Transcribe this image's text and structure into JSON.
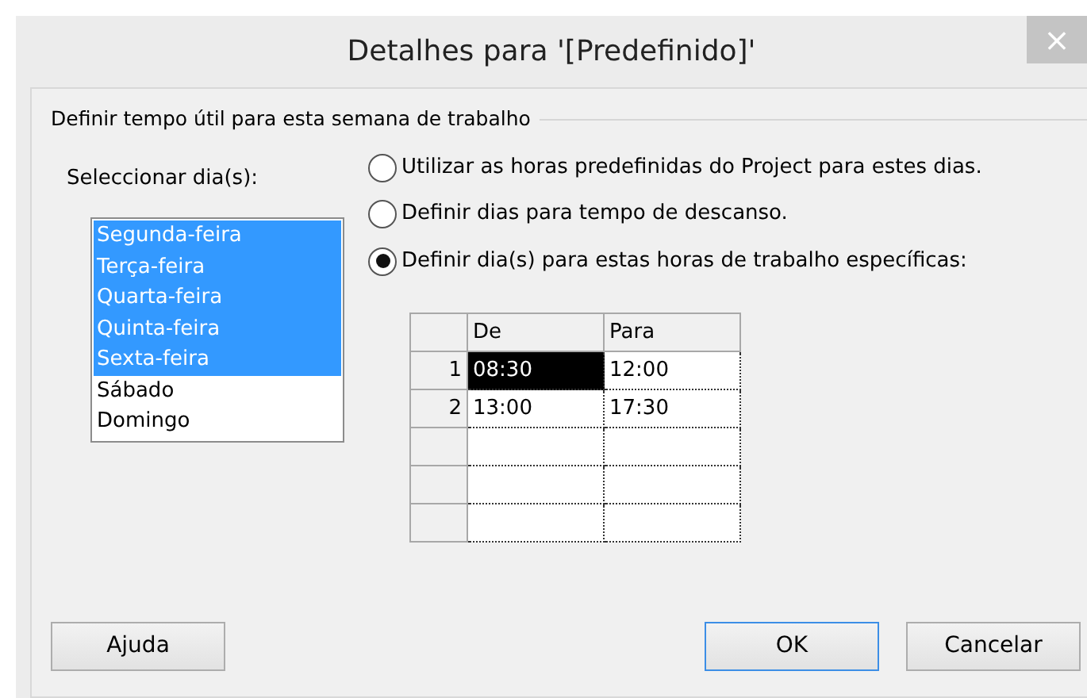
{
  "window": {
    "title": "Detalhes para '[Predefinido]'",
    "close": "×"
  },
  "group": {
    "title": "Definir tempo útil para esta semana de trabalho"
  },
  "days_label": "Seleccionar dia(s):",
  "days": [
    {
      "label": "Segunda-feira",
      "selected": true
    },
    {
      "label": "Terça-feira",
      "selected": true
    },
    {
      "label": "Quarta-feira",
      "selected": true
    },
    {
      "label": "Quinta-feira",
      "selected": true
    },
    {
      "label": "Sexta-feira",
      "selected": true
    },
    {
      "label": "Sábado",
      "selected": false
    },
    {
      "label": "Domingo",
      "selected": false
    }
  ],
  "options": [
    {
      "label": "Utilizar as horas predefinidas do Project para estes dias.",
      "selected": false
    },
    {
      "label": "Definir dias para tempo de descanso.",
      "selected": false
    },
    {
      "label": "Definir dia(s) para estas horas de trabalho específicas:",
      "selected": true
    }
  ],
  "table": {
    "columns": [
      "De",
      "Para"
    ],
    "rows": [
      {
        "number": "1",
        "cells": [
          {
            "text": "08:30",
            "selected": true
          },
          {
            "text": "12:00",
            "selected": false
          }
        ]
      },
      {
        "number": "2",
        "cells": [
          {
            "text": "13:00",
            "selected": false
          },
          {
            "text": "17:30",
            "selected": false
          }
        ]
      },
      {
        "cells": [
          {
            "selected": false
          },
          {
            "selected": false
          }
        ]
      },
      {
        "cells": [
          {
            "selected": false
          },
          {
            "selected": false
          }
        ]
      },
      {
        "cells": [
          {
            "selected": false
          },
          {
            "selected": false
          }
        ]
      }
    ]
  },
  "buttons": [
    {
      "label": "Ajuda",
      "default": false,
      "kind": "help"
    },
    {
      "label": "OK",
      "default": true,
      "kind": "action"
    },
    {
      "label": "Cancelar",
      "default": false,
      "kind": "action"
    }
  ]
}
